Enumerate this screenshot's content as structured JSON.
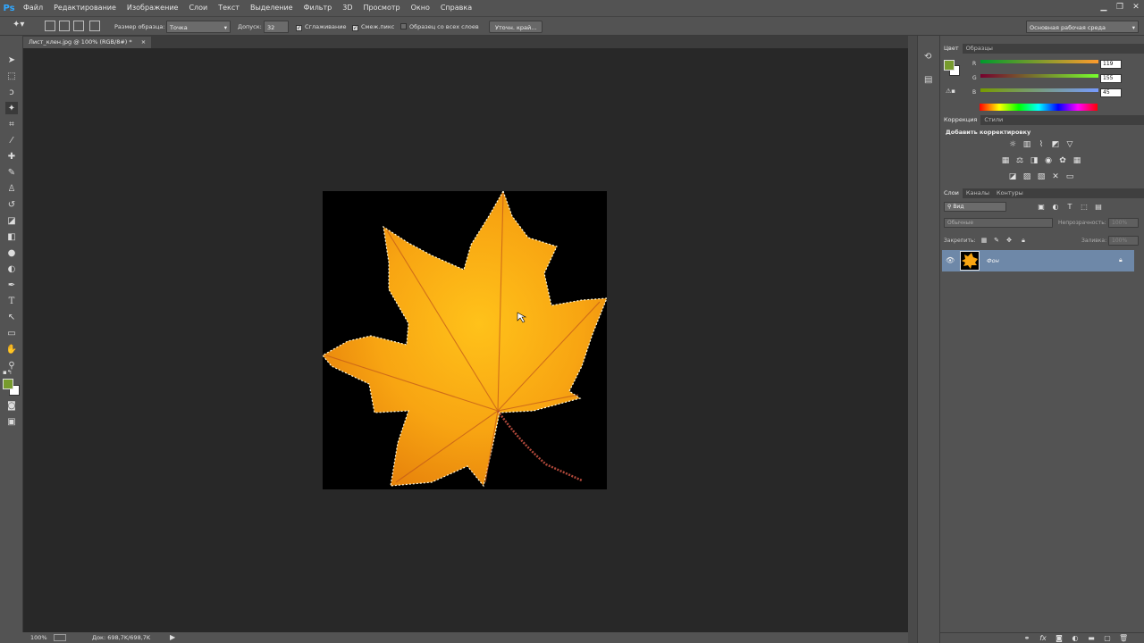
{
  "app": {
    "logo": "Ps"
  },
  "menu": [
    "Файл",
    "Редактирование",
    "Изображение",
    "Слои",
    "Текст",
    "Выделение",
    "Фильтр",
    "3D",
    "Просмотр",
    "Окно",
    "Справка"
  ],
  "window_controls": {
    "minimize": "▁",
    "restore": "❐",
    "close": "✕"
  },
  "options": {
    "sample_size_label": "Размер образца:",
    "sample_size_value": "Точка",
    "tolerance_label": "Допуск:",
    "tolerance_value": "32",
    "antialias_label": "Сглаживание",
    "contiguous_label": "Смеж.пикс",
    "all_layers_label": "Образец со всех слоев",
    "refine_edge_label": "Уточн. край...",
    "workspace_value": "Основная рабочая среда"
  },
  "document": {
    "tab_title": "Лист_клен.jpg @ 100% (RGB/8#) *",
    "tab_close": "×"
  },
  "status": {
    "zoom": "100%",
    "doc_info": "Док: 698,7K/698,7K"
  },
  "color_panel": {
    "tabs": [
      "Цвет",
      "Образцы"
    ],
    "r_label": "R",
    "g_label": "G",
    "b_label": "B",
    "r": 119,
    "g": 155,
    "b": 45,
    "foreground": "#779b2d",
    "background": "#ffffff"
  },
  "adjustments_panel": {
    "tabs": [
      "Коррекция",
      "Стили"
    ],
    "heading": "Добавить корректировку"
  },
  "layers_panel": {
    "tabs": [
      "Слои",
      "Каналы",
      "Контуры"
    ],
    "kind_filter": "Вид",
    "blend_mode": "Обычные",
    "opacity_label": "Непрозрачность:",
    "opacity_value": "100%",
    "lock_label": "Закрепить:",
    "fill_label": "Заливка:",
    "fill_value": "100%",
    "layers": [
      {
        "name": "Фон",
        "visible": true,
        "locked": true
      }
    ]
  }
}
